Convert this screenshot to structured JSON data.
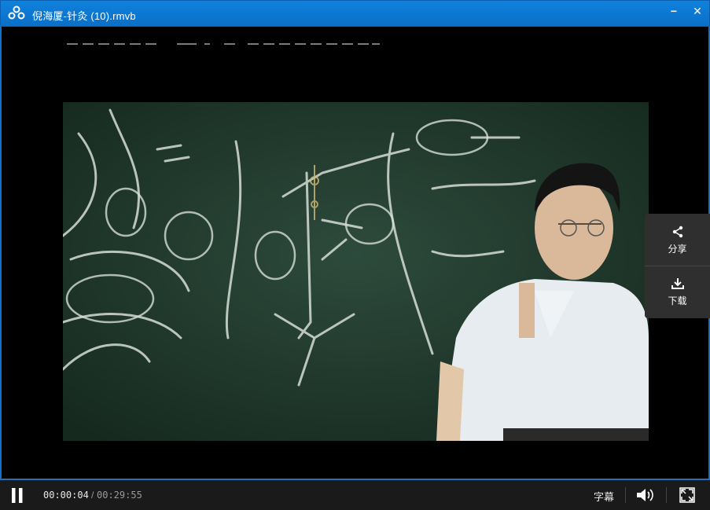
{
  "window": {
    "title": "倪海厦-针灸 (10).rmvb",
    "minimize_glyph": "−",
    "close_glyph": "✕",
    "logo_icon": "cloud-people-icon"
  },
  "video": {
    "frame_icon": "lecture-video-frame"
  },
  "side_panel": {
    "share_label": "分享",
    "download_label": "下载"
  },
  "controls": {
    "current_time": "00:00:04",
    "separator": "/",
    "total_time": "00:29:55",
    "subtitle_label": "字幕"
  },
  "colors": {
    "titlebar": "#0a6fc7",
    "controlbar": "#1a1a1a",
    "accent": "#2a6db5"
  }
}
